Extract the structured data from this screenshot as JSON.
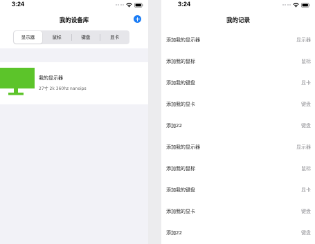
{
  "left_screen": {
    "status": {
      "time": "3:24"
    },
    "nav": {
      "title": "我的设备库",
      "add_icon": "plus-circle-icon"
    },
    "segments": [
      {
        "label": "显示器",
        "selected": true
      },
      {
        "label": "鼠标",
        "selected": false
      },
      {
        "label": "键盘",
        "selected": false
      },
      {
        "label": "显卡",
        "selected": false
      }
    ],
    "devices": [
      {
        "icon": "monitor-icon",
        "icon_color": "#5cc42a",
        "name": "我的显示器",
        "detail": "27寸 2k 360hz nanoips"
      }
    ]
  },
  "right_screen": {
    "status": {
      "time": "3:24"
    },
    "nav": {
      "title": "我的记录"
    },
    "records": [
      {
        "title": "添加我的显示器",
        "type": "显示器"
      },
      {
        "title": "添加我的鼠标",
        "type": "鼠标"
      },
      {
        "title": "添加我的键盘",
        "type": "显卡"
      },
      {
        "title": "添加我的显卡",
        "type": "键盘"
      },
      {
        "title": "添加22",
        "type": "键盘"
      },
      {
        "title": "添加我的显示器",
        "type": "显示器"
      },
      {
        "title": "添加我的鼠标",
        "type": "鼠标"
      },
      {
        "title": "添加我的键盘",
        "type": "显卡"
      },
      {
        "title": "添加我的显卡",
        "type": "键盘"
      },
      {
        "title": "添加22",
        "type": "键盘"
      }
    ]
  },
  "colors": {
    "accent": "#1a7cf5",
    "monitor_green": "#5cc42a",
    "grouped_background": "#f2f2f7",
    "secondary_text": "#8e8e93"
  }
}
